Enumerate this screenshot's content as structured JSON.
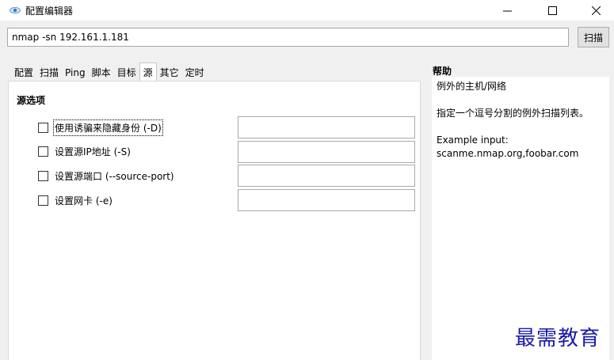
{
  "window": {
    "title": "配置编辑器",
    "icon": "eye-icon",
    "controls": {
      "minimize": "—",
      "maximize": "☐",
      "close": "✕"
    }
  },
  "command": {
    "value": "nmap -sn 192.161.1.181",
    "scan_label": "扫描"
  },
  "tabs": [
    {
      "label": "配置",
      "active": false
    },
    {
      "label": "扫描",
      "active": false
    },
    {
      "label": "Ping",
      "active": false
    },
    {
      "label": "脚本",
      "active": false
    },
    {
      "label": "目标",
      "active": false
    },
    {
      "label": "源",
      "active": true
    },
    {
      "label": "其它",
      "active": false
    },
    {
      "label": "定时",
      "active": false
    }
  ],
  "source_options": {
    "title": "源选项",
    "options": [
      {
        "label": "使用诱骗来隐藏身份 (-D)",
        "checked": false,
        "value": ""
      },
      {
        "label": "设置源IP地址 (-S)",
        "checked": false,
        "value": ""
      },
      {
        "label": "设置源端口 (--source-port)",
        "checked": false,
        "value": ""
      },
      {
        "label": "设置网卡 (-e)",
        "checked": false,
        "value": ""
      }
    ]
  },
  "help": {
    "title": "帮助",
    "heading": "例外的主机/网络",
    "description": "指定一个逗号分割的例外扫描列表。",
    "example_label": "Example input:",
    "example_value": "scanme.nmap.org,foobar.com"
  },
  "watermark": "最需教育"
}
